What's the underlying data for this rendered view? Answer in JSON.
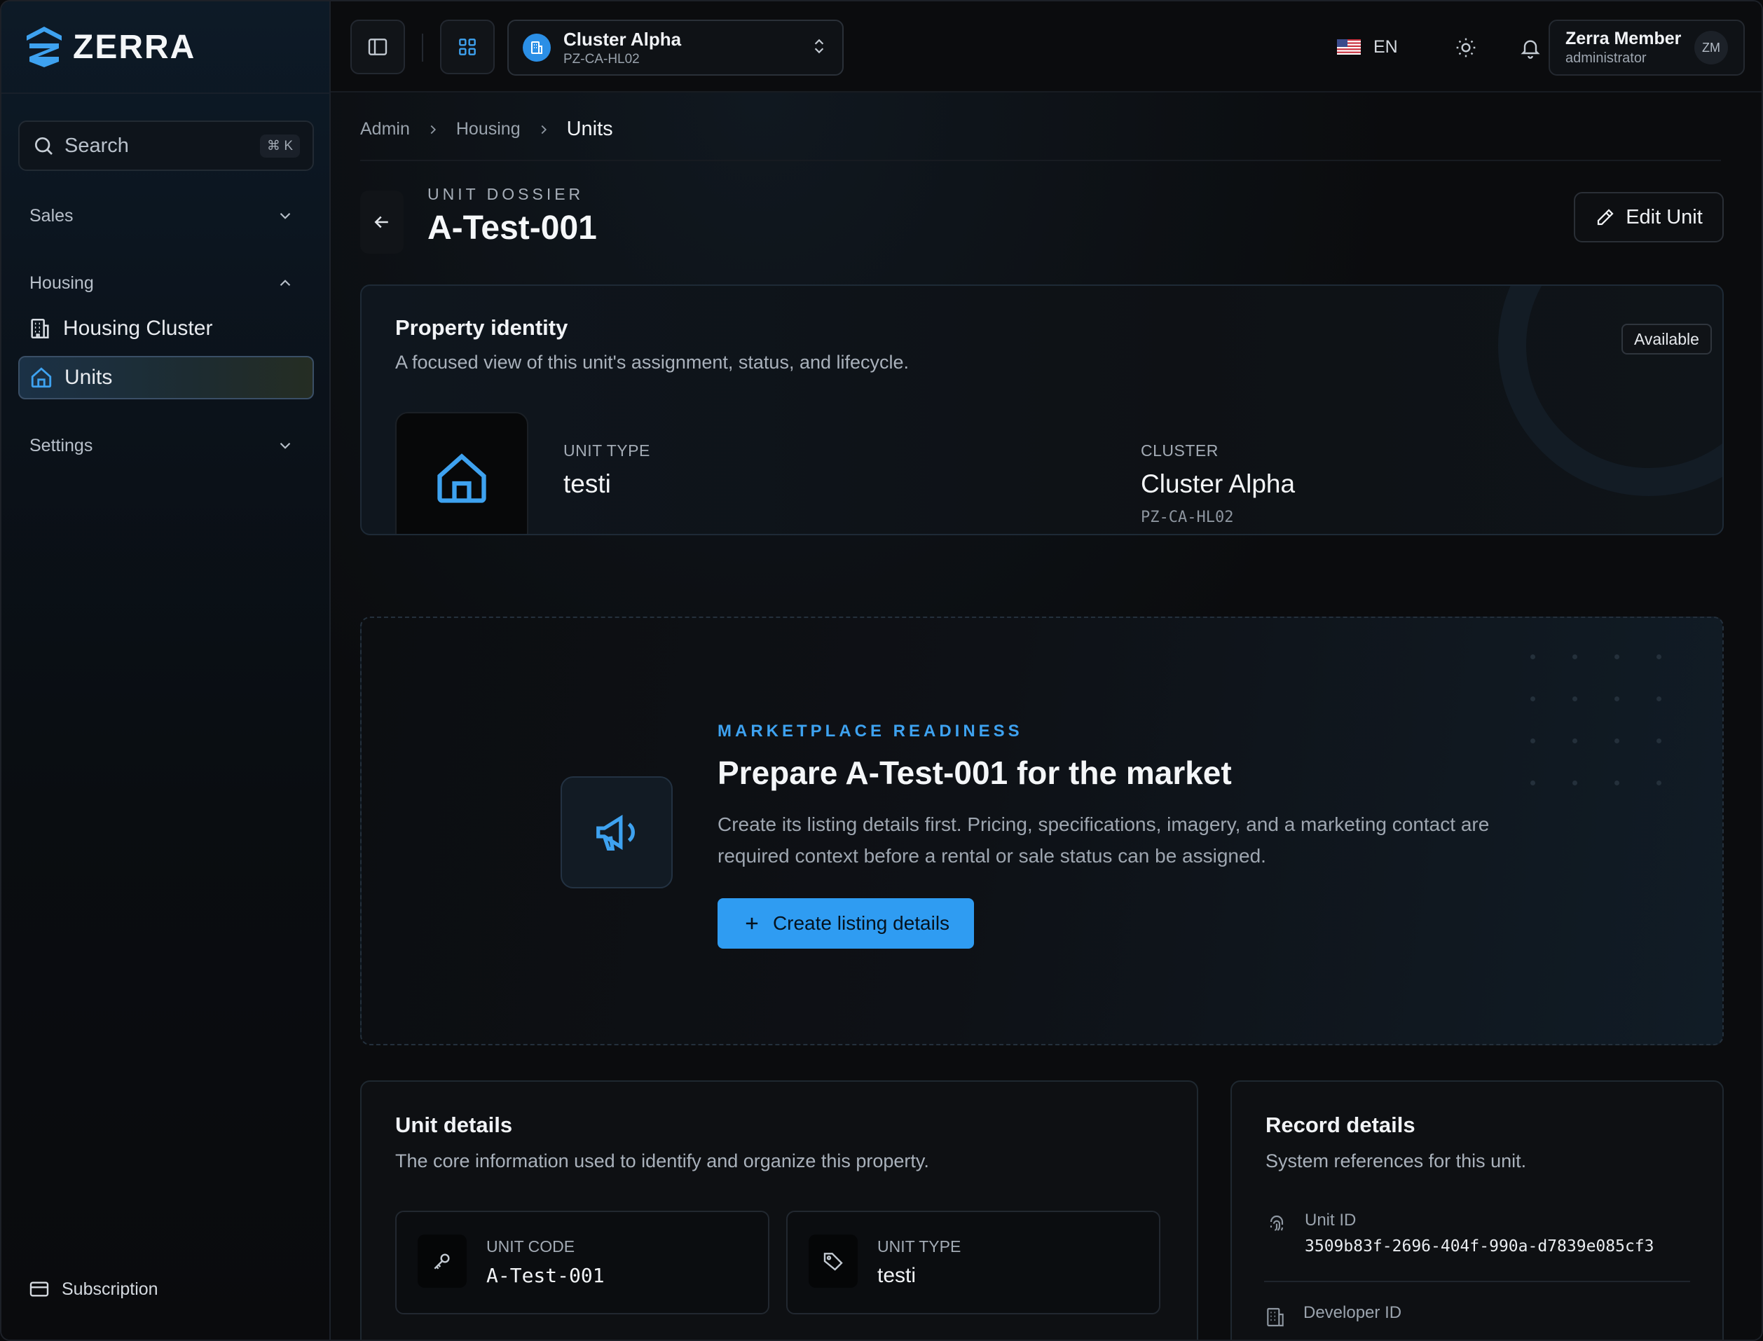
{
  "app": {
    "logo_text": "ZERRA",
    "accent": "#2f9cf2"
  },
  "sidebar": {
    "search_placeholder": "Search",
    "search_shortcut": "⌘ K",
    "sections": {
      "sales": "Sales",
      "housing": "Housing",
      "settings": "Settings"
    },
    "items": [
      {
        "label": "Housing Cluster",
        "icon": "building-icon",
        "active": false
      },
      {
        "label": "Units",
        "icon": "home-icon",
        "active": true
      }
    ],
    "subscription_label": "Subscription"
  },
  "topbar": {
    "cluster_name": "Cluster Alpha",
    "cluster_code": "PZ-CA-HL02",
    "language": "EN",
    "user_name": "Zerra Member",
    "user_role": "administrator",
    "user_initials": "ZM"
  },
  "breadcrumb": [
    "Admin",
    "Housing",
    "Units"
  ],
  "header": {
    "eyebrow": "UNIT DOSSIER",
    "title": "A-Test-001",
    "edit_label": "Edit Unit"
  },
  "identity": {
    "title": "Property identity",
    "subtitle": "A focused view of this unit's assignment, status, and lifecycle.",
    "status": "Available",
    "unit_type_label": "UNIT TYPE",
    "unit_type_value": "testi",
    "cluster_label": "CLUSTER",
    "cluster_value": "Cluster Alpha",
    "cluster_code": "PZ-CA-HL02"
  },
  "marketplace": {
    "eyebrow": "MARKETPLACE READINESS",
    "title": "Prepare A-Test-001 for the market",
    "description": "Create its listing details first. Pricing, specifications, imagery, and a marketing contact are required context before a rental or sale status can be assigned.",
    "button_label": "Create listing details"
  },
  "unit_details": {
    "title": "Unit details",
    "subtitle": "The core information used to identify and organize this property.",
    "fields": [
      {
        "label": "UNIT CODE",
        "value": "A-Test-001",
        "icon": "key-icon"
      },
      {
        "label": "UNIT TYPE",
        "value": "testi",
        "icon": "tag-icon"
      }
    ]
  },
  "record_details": {
    "title": "Record details",
    "subtitle": "System references for this unit.",
    "unit_id_label": "Unit ID",
    "unit_id_value": "3509b83f-2696-404f-990a-d7839e085cf3",
    "developer_id_label": "Developer ID"
  }
}
